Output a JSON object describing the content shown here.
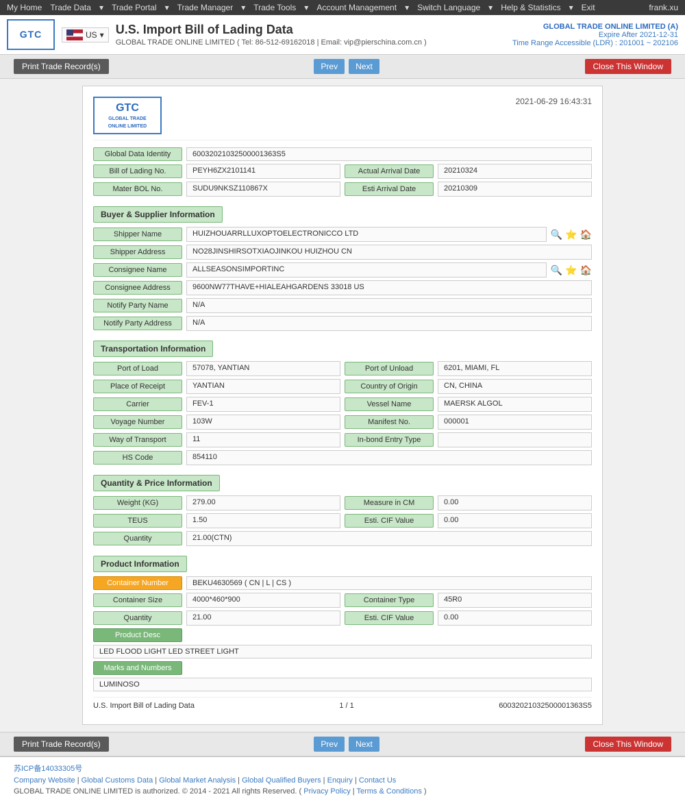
{
  "nav": {
    "items": [
      "My Home",
      "Trade Data",
      "Trade Portal",
      "Trade Manager",
      "Trade Tools",
      "Account Management",
      "Switch Language",
      "Help & Statistics",
      "Exit"
    ],
    "user": "frank.xu"
  },
  "header": {
    "logo_text": "GTC\nGLOBAL TRADE\nONLINE LIMITED",
    "flag_label": "US",
    "page_title": "U.S. Import Bill of Lading Data",
    "subtitle": "GLOBAL TRADE ONLINE LIMITED ( Tel: 86-512-69162018 | Email: vip@pierschina.com.cn )",
    "account_name": "GLOBAL TRADE ONLINE LIMITED (A)",
    "expire": "Expire After 2021-12-31",
    "time_range": "Time Range Accessible (LDR) : 201001 ~ 202106"
  },
  "toolbar": {
    "print_label": "Print Trade Record(s)",
    "prev_label": "Prev",
    "next_label": "Next",
    "close_label": "Close This Window"
  },
  "document": {
    "timestamp": "2021-06-29 16:43:31",
    "logo_text": "GTC\nGLOBAL TRADE\nONLINE LIMITED",
    "global_data_identity_label": "Global Data Identity",
    "global_data_identity_value": "60032021032500001363S5",
    "bill_of_lading_no_label": "Bill of Lading No.",
    "bill_of_lading_no_value": "PEYH6ZX2101141",
    "actual_arrival_date_label": "Actual Arrival Date",
    "actual_arrival_date_value": "20210324",
    "mater_bol_no_label": "Mater BOL No.",
    "mater_bol_no_value": "SUDU9NKSZ110867X",
    "esti_arrival_date_label": "Esti Arrival Date",
    "esti_arrival_date_value": "20210309",
    "buyer_supplier_section": "Buyer & Supplier Information",
    "shipper_name_label": "Shipper Name",
    "shipper_name_value": "HUIZHOUARRLLUXOPTOELECTRONICCO LTD",
    "shipper_address_label": "Shipper Address",
    "shipper_address_value": "NO28JINSHIRSOTXIAOJINKOU HUIZHOU CN",
    "consignee_name_label": "Consignee Name",
    "consignee_name_value": "ALLSEASONSIMPORTINC",
    "consignee_address_label": "Consignee Address",
    "consignee_address_value": "9600NW77THAVE+HIALEAHGARDENS 33018 US",
    "notify_party_name_label": "Notify Party Name",
    "notify_party_name_value": "N/A",
    "notify_party_address_label": "Notify Party Address",
    "notify_party_address_value": "N/A",
    "transportation_section": "Transportation Information",
    "port_of_load_label": "Port of Load",
    "port_of_load_value": "57078, YANTIAN",
    "port_of_unload_label": "Port of Unload",
    "port_of_unload_value": "6201, MIAMI, FL",
    "place_of_receipt_label": "Place of Receipt",
    "place_of_receipt_value": "YANTIAN",
    "country_of_origin_label": "Country of Origin",
    "country_of_origin_value": "CN, CHINA",
    "carrier_label": "Carrier",
    "carrier_value": "FEV-1",
    "vessel_name_label": "Vessel Name",
    "vessel_name_value": "MAERSK ALGOL",
    "voyage_number_label": "Voyage Number",
    "voyage_number_value": "103W",
    "manifest_no_label": "Manifest No.",
    "manifest_no_value": "000001",
    "way_of_transport_label": "Way of Transport",
    "way_of_transport_value": "11",
    "inbond_entry_type_label": "In-bond Entry Type",
    "inbond_entry_type_value": "",
    "hs_code_label": "HS Code",
    "hs_code_value": "854110",
    "quantity_price_section": "Quantity & Price Information",
    "weight_kg_label": "Weight (KG)",
    "weight_kg_value": "279.00",
    "measure_in_cm_label": "Measure in CM",
    "measure_in_cm_value": "0.00",
    "teus_label": "TEUS",
    "teus_value": "1.50",
    "esti_cif_value_label": "Esti. CIF Value",
    "esti_cif_value_value": "0.00",
    "quantity_label": "Quantity",
    "quantity_value": "21.00(CTN)",
    "product_section": "Product Information",
    "container_number_label": "Container Number",
    "container_number_value": "BEKU4630569 ( CN | L | CS )",
    "container_size_label": "Container Size",
    "container_size_value": "4000*460*900",
    "container_type_label": "Container Type",
    "container_type_value": "45R0",
    "quantity2_label": "Quantity",
    "quantity2_value": "21.00",
    "esti_cif_value2_label": "Esti. CIF Value",
    "esti_cif_value2_value": "0.00",
    "product_desc_label": "Product Desc",
    "product_desc_value": "LED FLOOD LIGHT LED STREET LIGHT",
    "marks_numbers_label": "Marks and Numbers",
    "marks_numbers_value": "LUMINOSO",
    "footer_doc_label": "U.S. Import Bill of Lading Data",
    "footer_page": "1 / 1",
    "footer_id": "60032021032500001363S5"
  },
  "bottom_toolbar": {
    "print_label": "Print Trade Record(s)",
    "prev_label": "Prev",
    "next_label": "Next",
    "close_label": "Close This Window"
  },
  "site_footer": {
    "icp": "苏ICP备14033305号",
    "company_website": "Company Website",
    "global_customs_data": "Global Customs Data",
    "global_market_analysis": "Global Market Analysis",
    "global_qualified_buyers": "Global Qualified Buyers",
    "enquiry": "Enquiry",
    "contact_us": "Contact Us",
    "copyright": "GLOBAL TRADE ONLINE LIMITED is authorized. © 2014 - 2021 All rights Reserved.",
    "privacy_policy": "Privacy Policy",
    "terms_conditions": "Terms & Conditions"
  }
}
